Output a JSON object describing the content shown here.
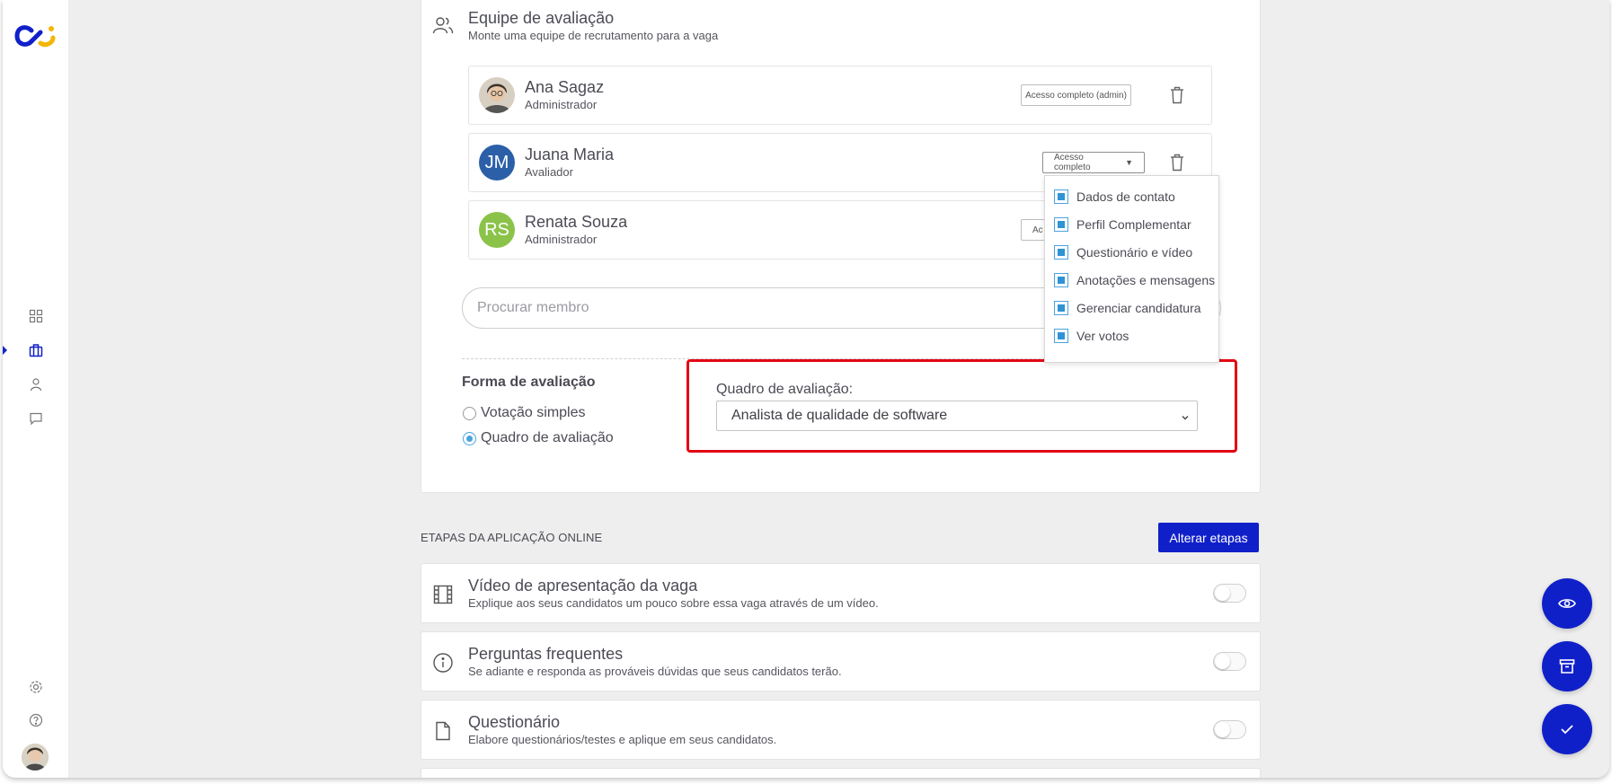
{
  "team": {
    "title": "Equipe de avaliação",
    "subtitle": "Monte uma equipe de recrutamento para a vaga",
    "members": [
      {
        "name": "Ana Sagaz",
        "role": "Administrador",
        "access": "Acesso completo (admin)",
        "initials": ""
      },
      {
        "name": "Juana Maria",
        "role": "Avaliador",
        "access": "Acesso completo",
        "initials": "JM"
      },
      {
        "name": "Renata Souza",
        "role": "Administrador",
        "access": "Ac",
        "initials": "RS"
      }
    ],
    "search_placeholder": "Procurar membro"
  },
  "access_dropdown": {
    "options": [
      "Dados de contato",
      "Perfil Complementar",
      "Questionário e vídeo",
      "Anotações e mensagens",
      "Gerenciar candidatura",
      "Ver votos"
    ]
  },
  "evaluation": {
    "title": "Forma de avaliação",
    "options": [
      "Votação simples",
      "Quadro de avaliação"
    ],
    "selected": "Quadro de avaliação",
    "board_label": "Quadro de avaliação:",
    "board_value": "Analista de qualidade de software"
  },
  "steps": {
    "section_label": "ETAPAS DA APLICAÇÃO ONLINE",
    "change_button": "Alterar etapas",
    "items": [
      {
        "title": "Vídeo de apresentação da vaga",
        "subtitle": "Explique aos seus candidatos um pouco sobre essa vaga através de um vídeo.",
        "icon": "film-icon"
      },
      {
        "title": "Perguntas frequentes",
        "subtitle": "Se adiante e responda as prováveis dúvidas que seus candidatos terão.",
        "icon": "info-icon"
      },
      {
        "title": "Questionário",
        "subtitle": "Elabore questionários/testes e aplique em seus candidatos.",
        "icon": "document-icon"
      }
    ]
  },
  "colors": {
    "accent": "#1020c9",
    "highlight": "#e30613",
    "checkbox": "#2f93d6",
    "jm_avatar": "#2b5fa8",
    "rs_avatar": "#8bc34a"
  }
}
